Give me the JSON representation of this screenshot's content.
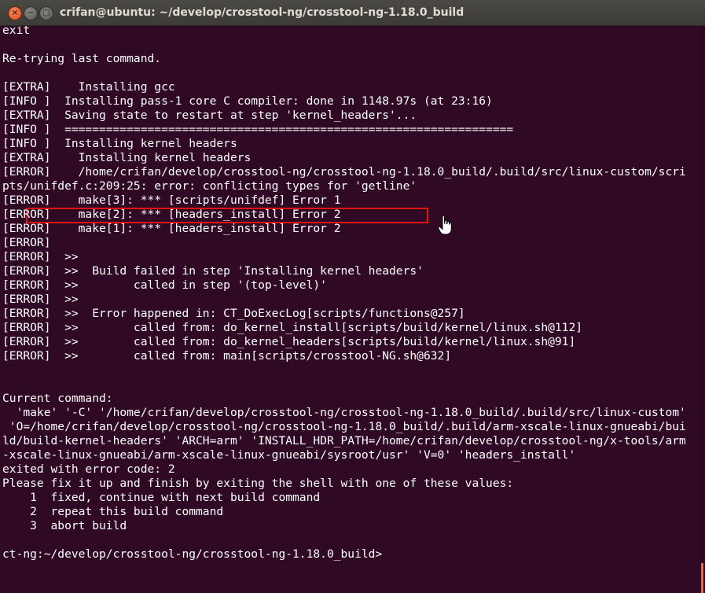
{
  "window": {
    "title": "crifan@ubuntu: ~/develop/crosstool-ng/crosstool-ng-1.18.0_build",
    "controls": {
      "close": "×",
      "minimize": "−",
      "maximize": "□"
    }
  },
  "terminal": {
    "lines": [
      "exit",
      "",
      "Re-trying last command.",
      "",
      "[EXTRA]    Installing gcc",
      "[INFO ]  Installing pass-1 core C compiler: done in 1148.97s (at 23:16)",
      "[EXTRA]  Saving state to restart at step 'kernel_headers'...",
      "[INFO ]  =================================================================",
      "[INFO ]  Installing kernel headers",
      "[EXTRA]    Installing kernel headers",
      "[ERROR]    /home/crifan/develop/crosstool-ng/crosstool-ng-1.18.0_build/.build/src/linux-custom/scri",
      "pts/unifdef.c:209:25: error: conflicting types for 'getline'",
      "[ERROR]    make[3]: *** [scripts/unifdef] Error 1",
      "[ERROR]    make[2]: *** [headers_install] Error 2",
      "[ERROR]    make[1]: *** [headers_install] Error 2",
      "[ERROR]",
      "[ERROR]  >>",
      "[ERROR]  >>  Build failed in step 'Installing kernel headers'",
      "[ERROR]  >>        called in step '(top-level)'",
      "[ERROR]  >>",
      "[ERROR]  >>  Error happened in: CT_DoExecLog[scripts/functions@257]",
      "[ERROR]  >>        called from: do_kernel_install[scripts/build/kernel/linux.sh@112]",
      "[ERROR]  >>        called from: do_kernel_headers[scripts/build/kernel/linux.sh@91]",
      "[ERROR]  >>        called from: main[scripts/crosstool-NG.sh@632]",
      "",
      "",
      "Current command:",
      "  'make' '-C' '/home/crifan/develop/crosstool-ng/crosstool-ng-1.18.0_build/.build/src/linux-custom'",
      " 'O=/home/crifan/develop/crosstool-ng/crosstool-ng-1.18.0_build/.build/arm-xscale-linux-gnueabi/bui",
      "ld/build-kernel-headers' 'ARCH=arm' 'INSTALL_HDR_PATH=/home/crifan/develop/crosstool-ng/x-tools/arm",
      "-xscale-linux-gnueabi/arm-xscale-linux-gnueabi/sysroot/usr' 'V=0' 'headers_install'",
      "exited with error code: 2",
      "Please fix it up and finish by exiting the shell with one of these values:",
      "    1  fixed, continue with next build command",
      "    2  repeat this build command",
      "    3  abort build",
      "",
      "ct-ng:~/develop/crosstool-ng/crosstool-ng-1.18.0_build>"
    ]
  },
  "colors": {
    "terminal_bg": "#300a24",
    "terminal_fg": "#ffffff",
    "highlight_border": "#e01212",
    "titlebar": "#3c3b37",
    "close_button": "#df4a16"
  },
  "icons": {
    "cursor": "hand-pointer-icon"
  }
}
